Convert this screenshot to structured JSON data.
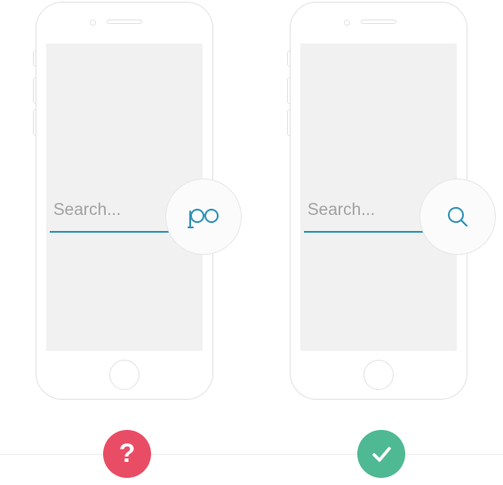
{
  "leftPhone": {
    "search": {
      "placeholder": "Search..."
    },
    "iconName": "binoculars-icon",
    "verdict": {
      "symbol": "?",
      "meaning": "unclear-icon"
    }
  },
  "rightPhone": {
    "search": {
      "placeholder": "Search..."
    },
    "iconName": "search-icon",
    "verdict": {
      "symbol": "✓",
      "meaning": "correct-icon"
    }
  },
  "colors": {
    "accent": "#3493b8",
    "bad": "#e94d65",
    "good": "#4fb994"
  }
}
